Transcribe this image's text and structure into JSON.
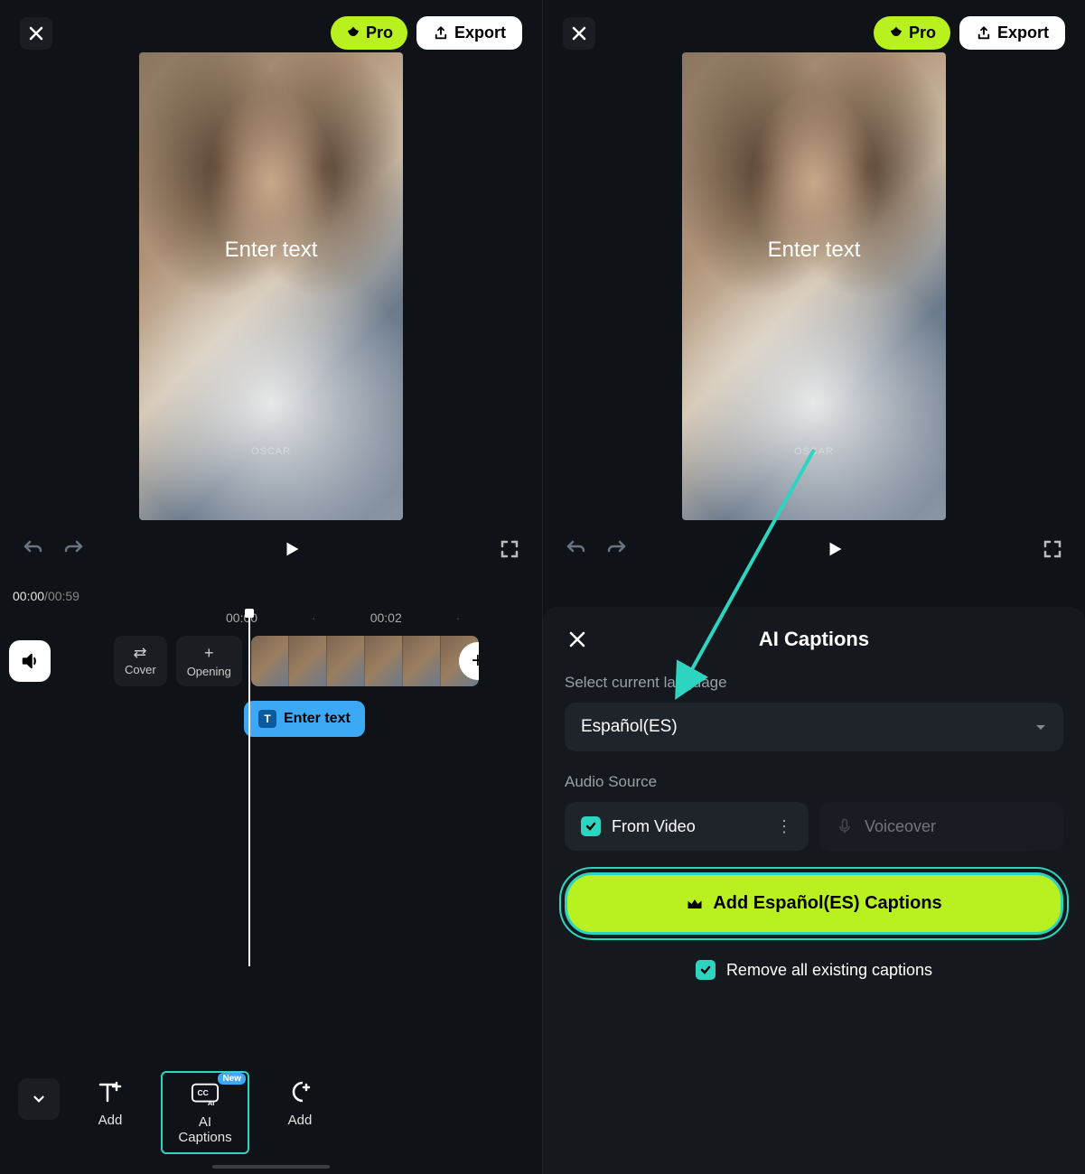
{
  "left": {
    "pro_label": "Pro",
    "export_label": "Export",
    "preview_placeholder": "Enter text",
    "watermark": "OSCAR",
    "time_current": "00:00",
    "time_total": "00:59",
    "ruler": [
      "00:00",
      "00:02"
    ],
    "clips": {
      "cover_label": "Cover",
      "opening_label": "Opening"
    },
    "text_clip_label": "Enter text",
    "tools": {
      "add1_label": "Add",
      "ai_captions_label": "AI Captions",
      "new_badge": "New",
      "add2_label": "Add"
    }
  },
  "right": {
    "pro_label": "Pro",
    "export_label": "Export",
    "preview_placeholder": "Enter text",
    "watermark": "OSCAR",
    "ai_panel": {
      "title": "AI Captions",
      "select_lang_label": "Select current language",
      "selected_language": "Español(ES)",
      "audio_source_label": "Audio Source",
      "from_video_label": "From Video",
      "voiceover_label": "Voiceover",
      "add_button_label": "Add Español(ES) Captions",
      "remove_label": "Remove all existing captions"
    }
  }
}
